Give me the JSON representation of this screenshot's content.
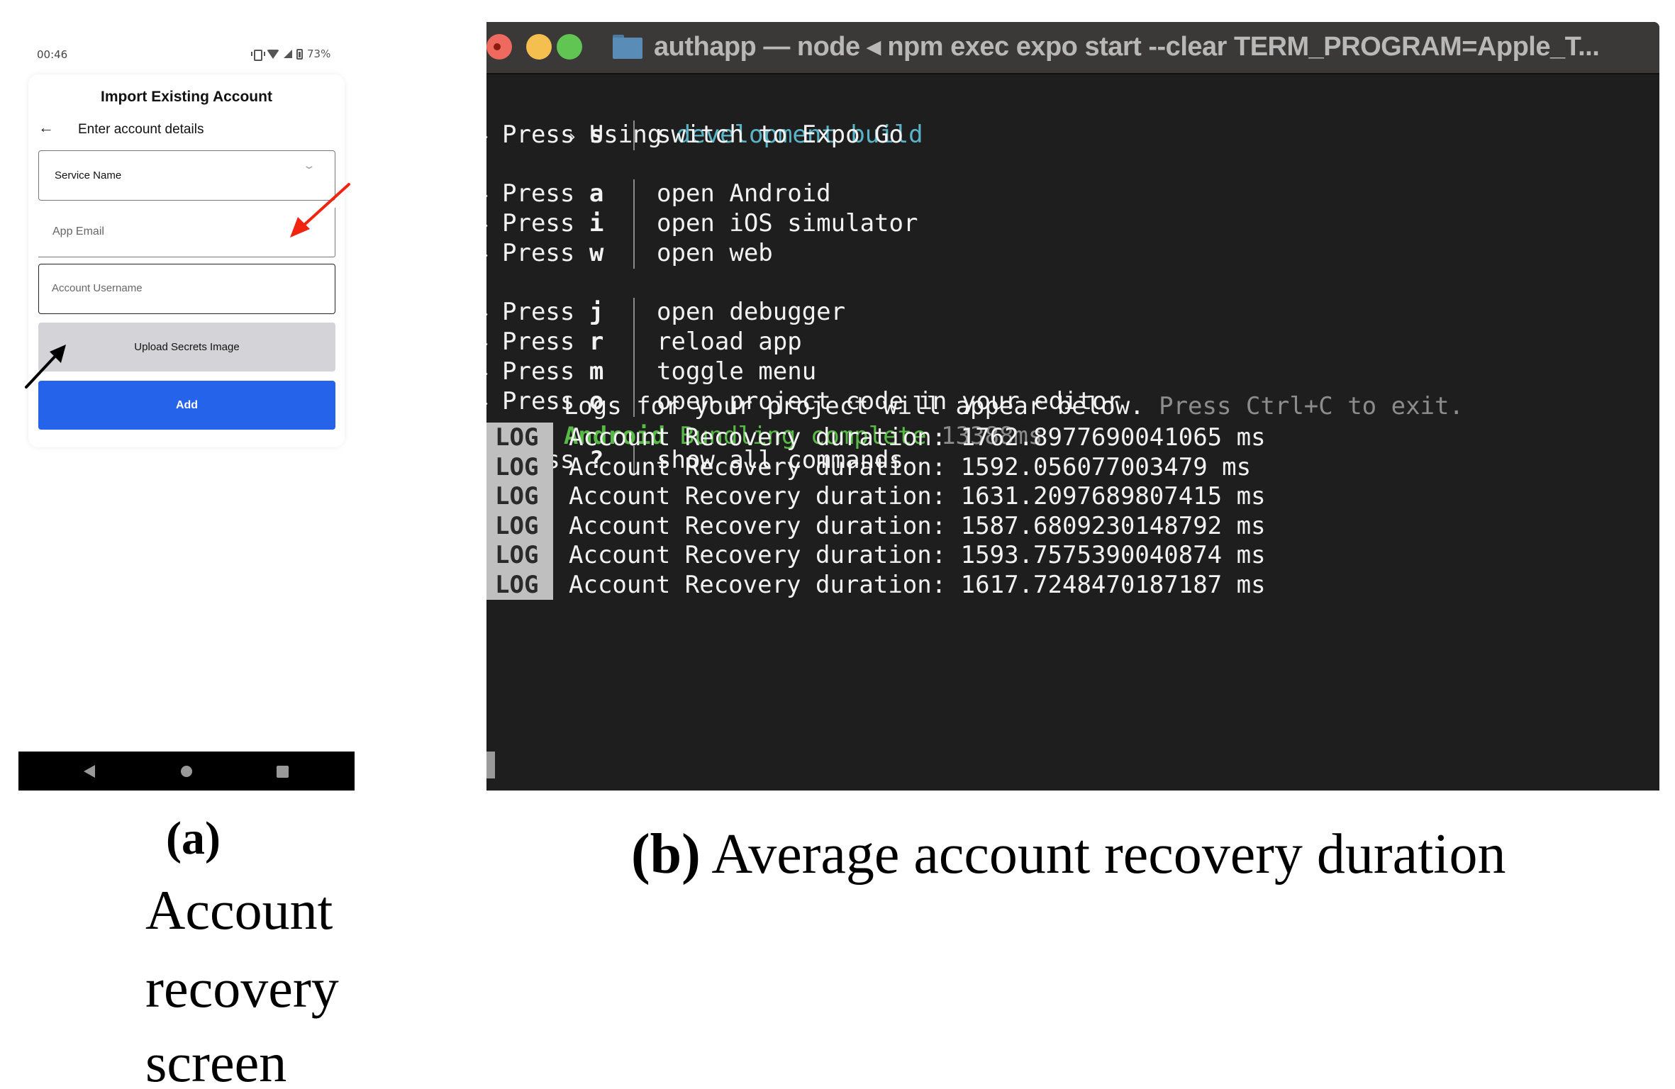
{
  "phone": {
    "status_bar": {
      "time": "00:46",
      "battery": "73%",
      "icons": [
        "vibrate-icon",
        "wifi-icon",
        "signal-icon",
        "battery-icon"
      ]
    },
    "screen_title": "Import Existing Account",
    "subtitle": "Enter account details",
    "fields": {
      "service_name": {
        "label": "Service Name",
        "value": ""
      },
      "app_email": {
        "placeholder": "App Email",
        "value": ""
      },
      "account_username": {
        "placeholder": "Account Username",
        "value": ""
      }
    },
    "buttons": {
      "upload": "Upload Secrets Image",
      "add": "Add"
    },
    "colors": {
      "add_button": "#2563eb",
      "upload_button": "#d4d4d8",
      "red_arrow": "#f0240f",
      "black_arrow": "#000000"
    }
  },
  "caption_a": {
    "label": "(a)",
    "lines": [
      "Account",
      "recovery",
      "screen"
    ]
  },
  "terminal": {
    "title": "authapp — node ◂ npm exec expo start --clear TERM_PROGRAM=Apple_T...",
    "using_prefix": "Using ",
    "using_highlight": "development build",
    "commands": [
      {
        "key": "s",
        "desc": "switch to Expo Go"
      },
      {
        "key": "a",
        "desc": "open Android"
      },
      {
        "key": "i",
        "desc": "open iOS simulator"
      },
      {
        "key": "w",
        "desc": "open web"
      },
      {
        "key": "j",
        "desc": "open debugger"
      },
      {
        "key": "r",
        "desc": "reload app"
      },
      {
        "key": "m",
        "desc": "toggle menu"
      },
      {
        "key": "o",
        "desc": "open project code in your editor"
      },
      {
        "key": "?",
        "desc": "show all commands"
      }
    ],
    "press_word": "Press",
    "prompt_glyph": "›",
    "logs_notice": "Logs for your project will appear below.",
    "logs_notice_dim": " Press Ctrl+C to exit.",
    "bundle_platform": "Android",
    "bundle_status": " Bundling complete ",
    "bundle_time": "13388ms",
    "log_badge": "LOG",
    "log_entries": [
      "Account Recovery duration: 1762.8977690041065 ms",
      "Account Recovery duration: 1592.056077003479 ms",
      "Account Recovery duration: 1631.2097689807415 ms",
      "Account Recovery duration: 1587.6809230148792 ms",
      "Account Recovery duration: 1593.7575390040874 ms",
      "Account Recovery duration: 1617.7248470187187 ms"
    ],
    "colors": {
      "background": "#1e1e1e",
      "titlebar": "#3a3938",
      "cyan": "#5ab4c6",
      "green": "#58b947",
      "dim": "#8c8c8c",
      "log_badge_bg": "#bfbfbf"
    }
  },
  "caption_b": {
    "label": "(b)",
    "text": " Average account recovery duration"
  }
}
